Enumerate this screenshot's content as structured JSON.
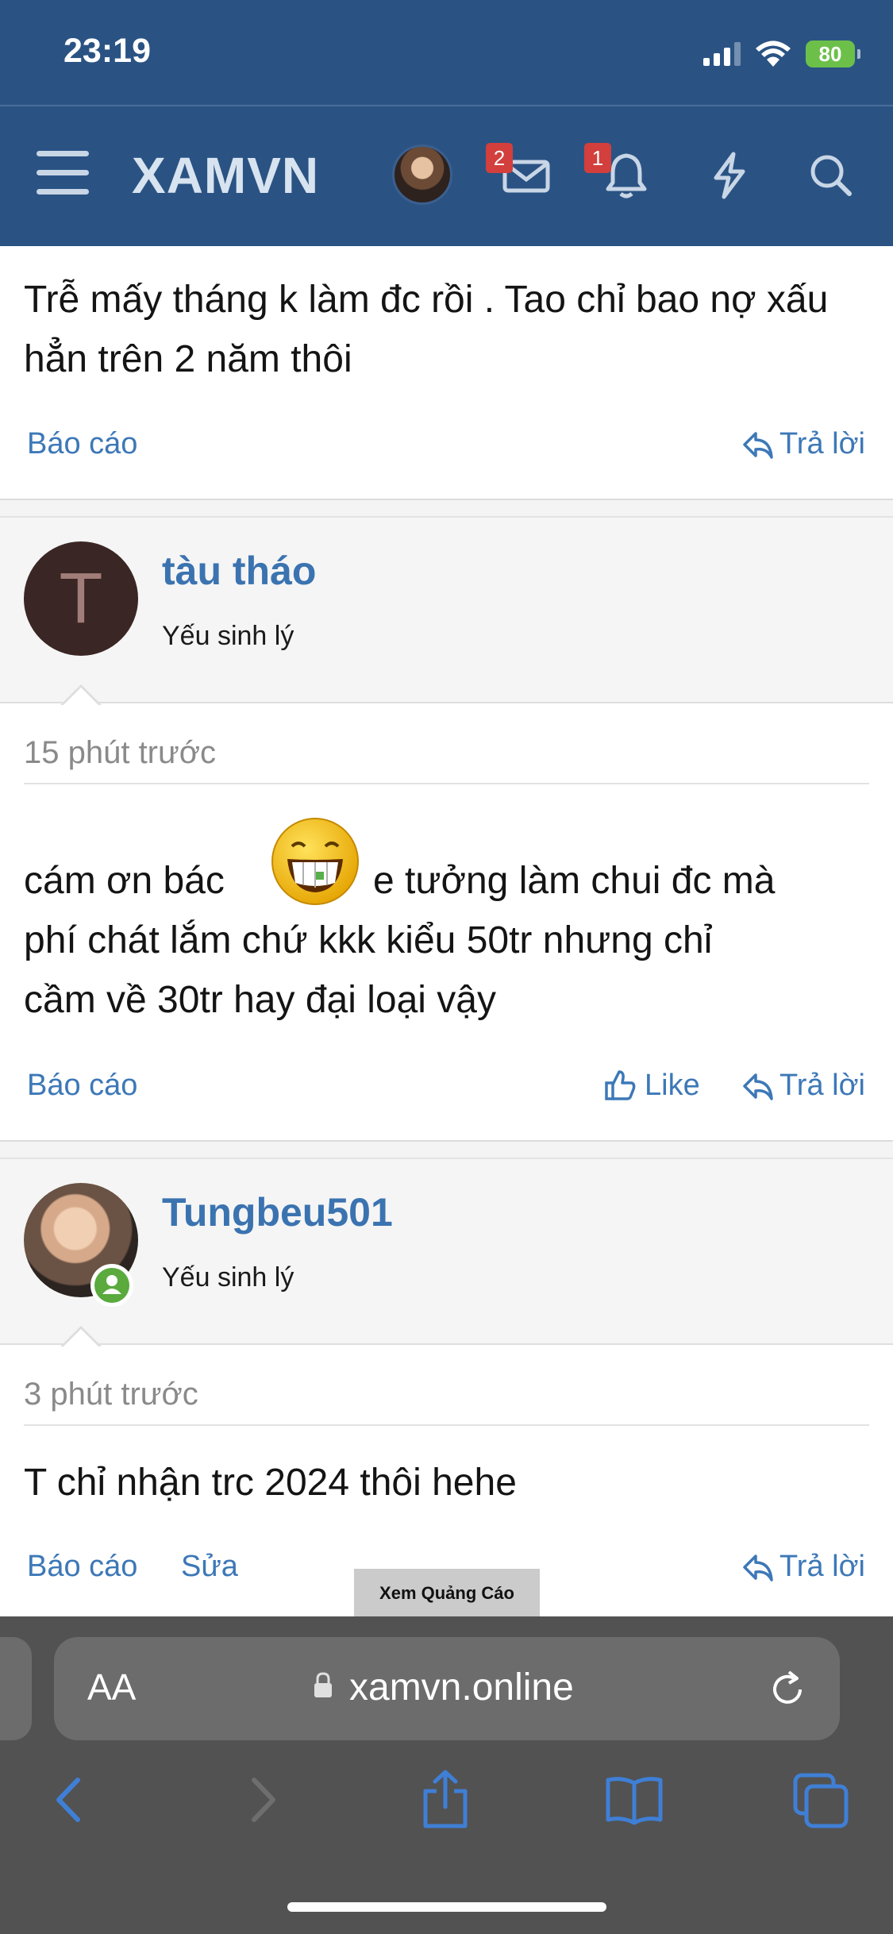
{
  "status_bar": {
    "time": "23:19",
    "battery": "80"
  },
  "header": {
    "logo": "XAMVN",
    "inbox_badge": "2",
    "alerts_badge": "1",
    "icons": [
      "menu-icon",
      "envelope-icon",
      "bell-icon",
      "bolt-icon",
      "search-icon"
    ]
  },
  "posts": [
    {
      "body": "Trễ mấy tháng k làm đc rồi . Tao chỉ bao nợ xấu hẳn trên 2 năm thôi",
      "actions": {
        "report": "Báo cáo",
        "reply": "Trả lời"
      }
    },
    {
      "author": "tàu tháo",
      "avatar_letter": "T",
      "user_title": "Yếu sinh lý",
      "time": "15 phút trước",
      "body_part1": "cám ơn bác",
      "body_part2": "e tưởng làm chui đc mà",
      "body_line2": "phí chát lắm chứ kkk kiểu 50tr nhưng chỉ",
      "body_line3": "cầm về 30tr hay đại loại vậy",
      "actions": {
        "report": "Báo cáo",
        "like": "Like",
        "reply": "Trả lời"
      }
    },
    {
      "author": "Tungbeu501",
      "user_title": "Yếu sinh lý",
      "time": "3 phút trước",
      "body": "T chỉ nhận trc 2024 thôi hehe",
      "actions": {
        "report": "Báo cáo",
        "edit": "Sửa",
        "reply": "Trả lời"
      }
    }
  ],
  "ad_label": "Xem Quảng Cáo",
  "browser": {
    "text_size": "AA",
    "url": "xamvn.online"
  },
  "colors": {
    "header": "#2a5384",
    "link": "#3d78b7",
    "username": "#3b73b0",
    "badge": "#d23f3c"
  }
}
